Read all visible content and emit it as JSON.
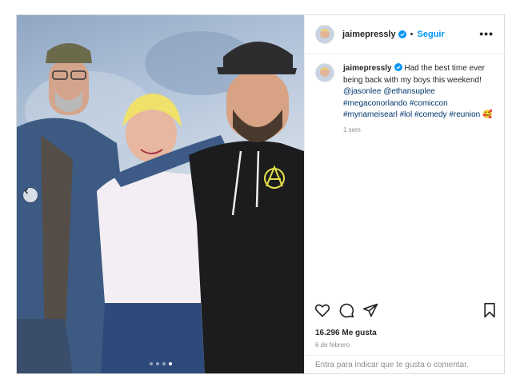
{
  "post": {
    "author": {
      "username": "jaimepressly",
      "verified": true
    },
    "follow_label": "Seguir",
    "separator": "•",
    "more_label": "•••",
    "caption": {
      "text": "Had the best time ever being back with my boys this weekend!",
      "mentions": [
        "@jasonlee",
        "@ethansuplee"
      ],
      "hashtags": [
        "#megaconorlando",
        "#comiccon",
        "#mynameisearl",
        "#lol",
        "#comedy",
        "#reunion"
      ],
      "emoji": "🥰",
      "time_ago": "1 sem"
    },
    "likes": "16.296 Me gusta",
    "date": "6 de febrero",
    "comment": {
      "link_label": "Entra",
      "prompt": "para indicar que te gusta o comentar."
    },
    "carousel": {
      "total_slides": 4,
      "active_slide": 4
    }
  },
  "colors": {
    "accent_blue": "#0095f6",
    "tag_blue": "#00376b",
    "muted": "#8e8e8e",
    "text": "#262626",
    "border": "#dbdbdb"
  },
  "icons": [
    "verified-badge-icon",
    "more-options-icon",
    "carousel-prev-icon",
    "heart-icon",
    "comment-icon",
    "share-icon",
    "bookmark-icon"
  ]
}
